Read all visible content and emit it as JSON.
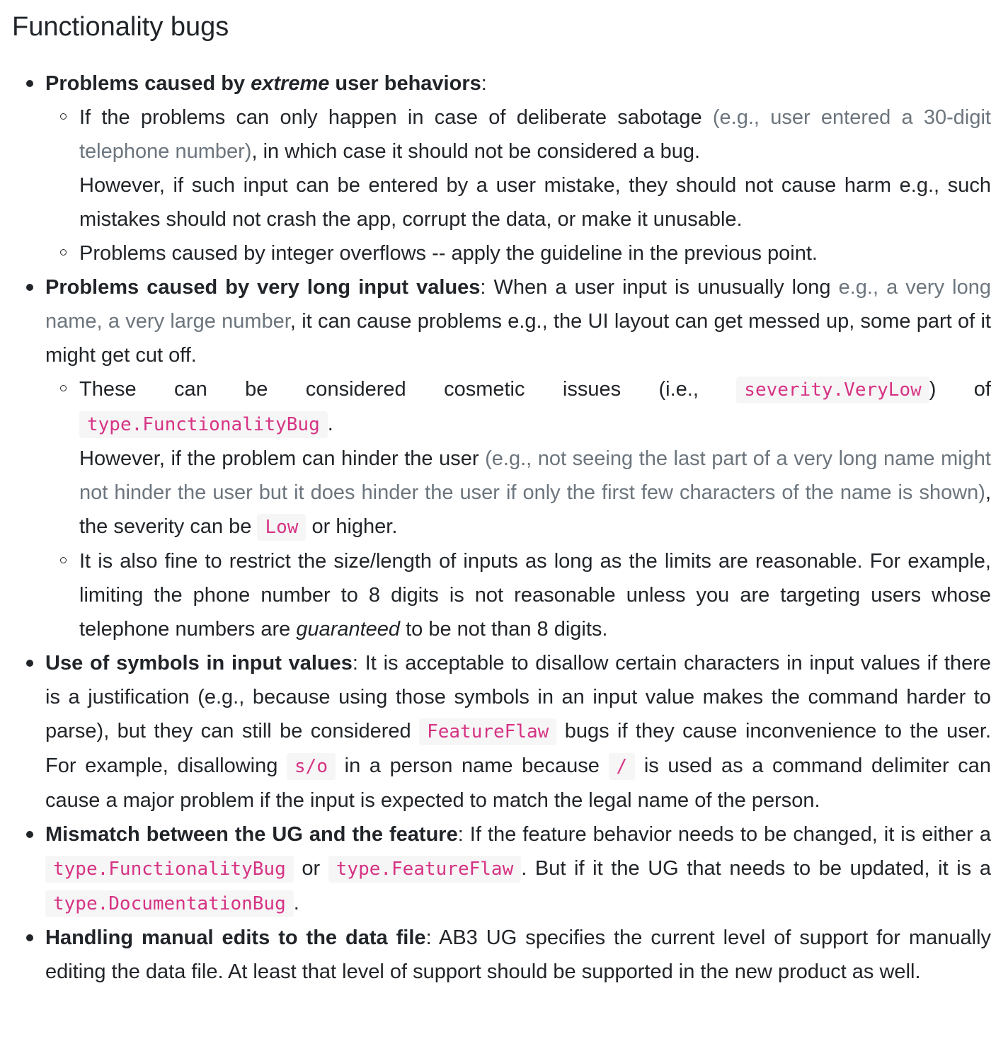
{
  "heading": "Functionality bugs",
  "items": [
    {
      "title_a": "Problems caused by ",
      "title_em": "extreme",
      "title_b": " user behaviors",
      "colon": ":",
      "sub": [
        {
          "p1": "If the problems can only happen in case of deliberate sabotage ",
          "muted": "(e.g., user entered a 30-digit telephone number)",
          "p2": ", in which case it should not be considered a bug.",
          "p3": "However, if such input can be entered by a user mistake, they should not cause harm e.g., such mistakes should not crash the app, corrupt the data, or make it unusable."
        },
        {
          "text": "Problems caused by integer overflows -- apply the guideline in the previous point."
        }
      ]
    },
    {
      "title": "Problems caused by very long input values",
      "p1": ": When a user input is unusually long ",
      "muted": "e.g., a very long name, a very large number",
      "p2": ", it can cause problems e.g., the UI layout can get messed up, some part of it might get cut off.",
      "sub": [
        {
          "p1": "These can be considered cosmetic issues (i.e., ",
          "code1": "severity.VeryLow",
          "p2": ") of ",
          "code2": "type.FunctionalityBug",
          "p3": ".",
          "p4": "However, if the problem can hinder the user ",
          "muted": "(e.g., not seeing the last part of a very long name might not hinder the user but it does hinder the user if only the first few characters of the name is shown)",
          "p5": ", the severity can be ",
          "code3": "Low",
          "p6": " or higher."
        },
        {
          "p1": "It is also fine to restrict the size/length of inputs as long as the limits are reasonable. For example, limiting the phone number to 8 digits is not reasonable unless you are targeting users whose telephone numbers are ",
          "em": "guaranteed",
          "p2": " to be not than 8 digits."
        }
      ]
    },
    {
      "title": "Use of symbols in input values",
      "p1": ": It is acceptable to disallow certain characters in input values if there is a justification (e.g., because using those symbols in an input value makes the command harder to parse), but they can still be considered ",
      "code1": "FeatureFlaw",
      "p2": " bugs if they cause inconvenience to the user. For example, disallowing ",
      "code2": "s/o",
      "p3": " in a person name because ",
      "code3": "/",
      "p4": " is used as a command delimiter can cause a major problem if the input is expected to match the legal name of the person."
    },
    {
      "title": "Mismatch between the UG and the feature",
      "p1": ": If the feature behavior needs to be changed, it is either a ",
      "code1": "type.FunctionalityBug",
      "p2": " or ",
      "code2": "type.FeatureFlaw",
      "p3": ". But if it the UG that needs to be updated, it is a ",
      "code3": "type.DocumentationBug",
      "p4": "."
    },
    {
      "title": "Handling manual edits to the data file",
      "p1": ": AB3 UG specifies the current level of support for manually editing the data file. At least that level of support should be supported in the new product as well."
    }
  ]
}
